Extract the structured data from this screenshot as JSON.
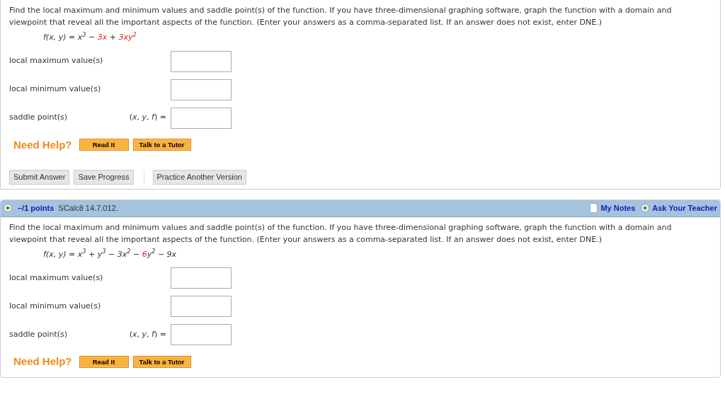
{
  "questions": [
    {
      "prompt": "Find the local maximum and minimum values and saddle point(s) of the function. If you have three-dimensional graphing software, graph the function with a domain and viewpoint that reveal all the important aspects of the function. (Enter your answers as a comma-separated list. If an answer does not exist, enter DNE.)",
      "formula": [
        {
          "text": "f(x, y) = x$^{3}$ − ",
          "highlight": false
        },
        {
          "text": "3x",
          "highlight": true
        },
        {
          "text": " + ",
          "highlight": false
        },
        {
          "text": "3xy$^{2}$",
          "highlight": true
        }
      ],
      "answers": [
        {
          "label": "local maximum value(s)"
        },
        {
          "label": "local minimum value(s)"
        },
        {
          "label": "saddle point(s)",
          "prefix": "(*x*, *y*, *f*) ="
        }
      ],
      "help": {
        "label": "Need Help?",
        "buttons": [
          "Read It",
          "Talk to a Tutor"
        ]
      },
      "actions": [
        "Submit Answer",
        "Save Progress"
      ],
      "extra_action": "Practice Another Version"
    },
    {
      "header": {
        "points": "–/1 points",
        "code": "SCalc8 14.7.012.",
        "links": [
          "My Notes",
          "Ask Your Teacher"
        ]
      },
      "prompt": "Find the local maximum and minimum values and saddle point(s) of the function. If you have three-dimensional graphing software, graph the function with a domain and viewpoint that reveal all the important aspects of the function. (Enter your answers as a comma-separated list. If an answer does not exist, enter DNE.)",
      "formula": [
        {
          "text": "f(x, y) = x$^{3}$ + y$^{3}$ − 3x$^{2}$ − ",
          "highlight": false
        },
        {
          "text": "6",
          "highlight": true
        },
        {
          "text": "y$^{2}$ − 9x",
          "highlight": false
        }
      ],
      "answers": [
        {
          "label": "local maximum value(s)"
        },
        {
          "label": "local minimum value(s)"
        },
        {
          "label": "saddle point(s)",
          "prefix": "(*x*, *y*, *f*) ="
        }
      ],
      "help": {
        "label": "Need Help?",
        "buttons": [
          "Read It",
          "Talk to a Tutor"
        ]
      }
    }
  ]
}
